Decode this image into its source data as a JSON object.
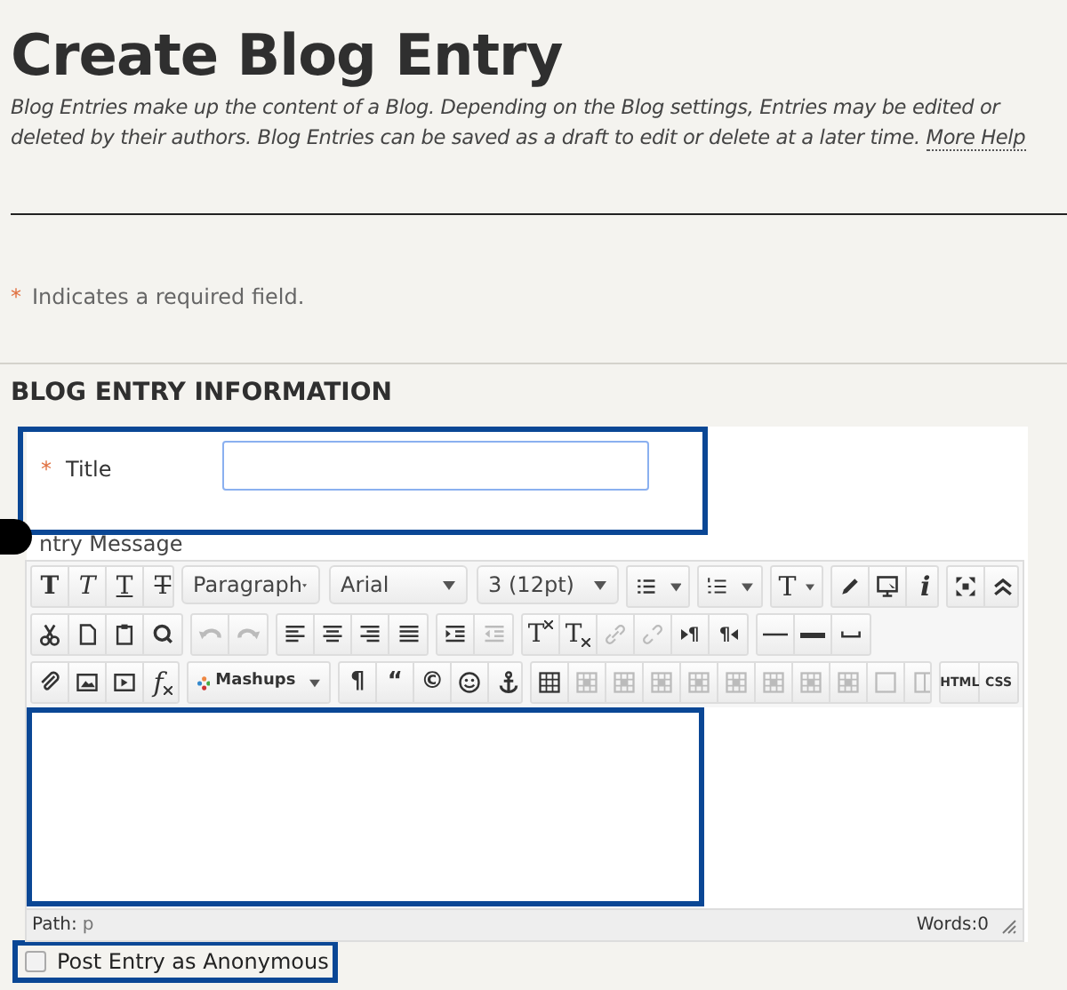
{
  "page_title": "Create Blog Entry",
  "description": "Blog Entries make up the content of a Blog. Depending on the Blog settings, Entries may be edited or deleted by their authors. Blog Entries can be saved as a draft to edit or delete at a later time.",
  "help_link": "More Help",
  "required_note": {
    "mark": "*",
    "text": "Indicates a required field."
  },
  "section_heading": "BLOG ENTRY INFORMATION",
  "title_field": {
    "required_mark": "*",
    "label": "Title"
  },
  "message_label": "ntry Message",
  "toolbar": {
    "rows": [
      {
        "groups": [
          {
            "items": [
              {
                "kind": "bold",
                "text": "T",
                "disabled": false
              },
              {
                "kind": "italic",
                "text": "T",
                "disabled": false
              },
              {
                "kind": "underline",
                "text": "T",
                "disabled": false
              },
              {
                "kind": "strike",
                "text": "T",
                "disabled": false
              }
            ]
          },
          {
            "kind": "dropdowns",
            "items": [
              {
                "kind": "dropdown",
                "text": "Paragraph",
                "disabled": false
              },
              {
                "kind": "dropdown",
                "text": "Arial",
                "disabled": false
              },
              {
                "kind": "dropdown",
                "text": "3 (12pt)",
                "disabled": false
              }
            ]
          },
          {
            "items": [
              {
                "kind": "bullet-list",
                "disabled": false
              }
            ]
          },
          {
            "items": [
              {
                "kind": "numbered-list",
                "disabled": false
              }
            ]
          },
          {
            "items": [
              {
                "kind": "text-color",
                "text": "T",
                "disabled": false
              }
            ]
          },
          {
            "items": [
              {
                "kind": "pencil",
                "disabled": false
              },
              {
                "kind": "monitor",
                "disabled": false
              },
              {
                "kind": "info",
                "text": "i",
                "disabled": false
              }
            ]
          },
          {
            "items": [
              {
                "kind": "fullscreen",
                "disabled": false
              },
              {
                "kind": "collapse",
                "disabled": false
              }
            ]
          }
        ]
      },
      {
        "groups": [
          {
            "items": [
              {
                "kind": "cut",
                "disabled": false
              },
              {
                "kind": "copy",
                "disabled": false
              },
              {
                "kind": "paste",
                "disabled": false
              },
              {
                "kind": "search",
                "disabled": false
              }
            ]
          },
          {
            "items": [
              {
                "kind": "undo",
                "disabled": true
              },
              {
                "kind": "redo",
                "disabled": true
              }
            ]
          },
          {
            "items": [
              {
                "kind": "align-left",
                "disabled": false
              },
              {
                "kind": "align-center",
                "disabled": false
              },
              {
                "kind": "align-right",
                "disabled": false
              },
              {
                "kind": "align-justify",
                "disabled": false
              }
            ]
          },
          {
            "items": [
              {
                "kind": "indent",
                "disabled": false
              },
              {
                "kind": "outdent",
                "disabled": true
              }
            ]
          },
          {
            "items": [
              {
                "kind": "superscript",
                "text": "T",
                "disabled": false
              },
              {
                "kind": "subscript",
                "text": "T",
                "disabled": false
              },
              {
                "kind": "link",
                "disabled": true
              },
              {
                "kind": "unlink",
                "disabled": true
              },
              {
                "kind": "ltr",
                "text": "¶",
                "disabled": false
              },
              {
                "kind": "rtl",
                "text": "¶",
                "disabled": false
              }
            ]
          },
          {
            "items": [
              {
                "kind": "rule-thin",
                "disabled": false
              },
              {
                "kind": "rule-thick",
                "disabled": false
              },
              {
                "kind": "space",
                "disabled": false
              }
            ]
          }
        ]
      },
      {
        "groups": [
          {
            "items": [
              {
                "kind": "attach",
                "disabled": false
              },
              {
                "kind": "image",
                "disabled": false
              },
              {
                "kind": "media",
                "disabled": false
              },
              {
                "kind": "formula",
                "text": "f",
                "disabled": false
              }
            ]
          },
          {
            "items": [
              {
                "kind": "mashups",
                "text": "Mashups",
                "disabled": false
              }
            ]
          },
          {
            "items": [
              {
                "kind": "glyph",
                "text": "¶",
                "disabled": false
              },
              {
                "kind": "glyph",
                "text": "“",
                "disabled": false
              },
              {
                "kind": "glyph",
                "text": "©",
                "disabled": false
              },
              {
                "kind": "smiley",
                "disabled": false
              },
              {
                "kind": "anchor",
                "disabled": false
              }
            ]
          },
          {
            "items": [
              {
                "kind": "table",
                "disabled": false
              },
              {
                "kind": "table-op",
                "disabled": true
              },
              {
                "kind": "table-op",
                "disabled": true
              },
              {
                "kind": "table-op",
                "disabled": true
              },
              {
                "kind": "table-op",
                "disabled": true
              },
              {
                "kind": "table-op",
                "disabled": true
              },
              {
                "kind": "table-op",
                "disabled": true
              },
              {
                "kind": "table-op",
                "disabled": true
              },
              {
                "kind": "table-op",
                "disabled": true
              },
              {
                "kind": "cell-box",
                "disabled": true
              },
              {
                "kind": "split-box",
                "disabled": true
              }
            ]
          },
          {
            "items": [
              {
                "kind": "small-text",
                "text": "HTML",
                "disabled": false
              },
              {
                "kind": "small-text",
                "text": "CSS",
                "disabled": false
              }
            ]
          }
        ]
      }
    ]
  },
  "status_bar": {
    "path_label": "Path:",
    "path_value": "p",
    "word_count": "Words:0"
  },
  "anonymous_option": {
    "label": "Post Entry as Anonymous",
    "checked": false
  }
}
